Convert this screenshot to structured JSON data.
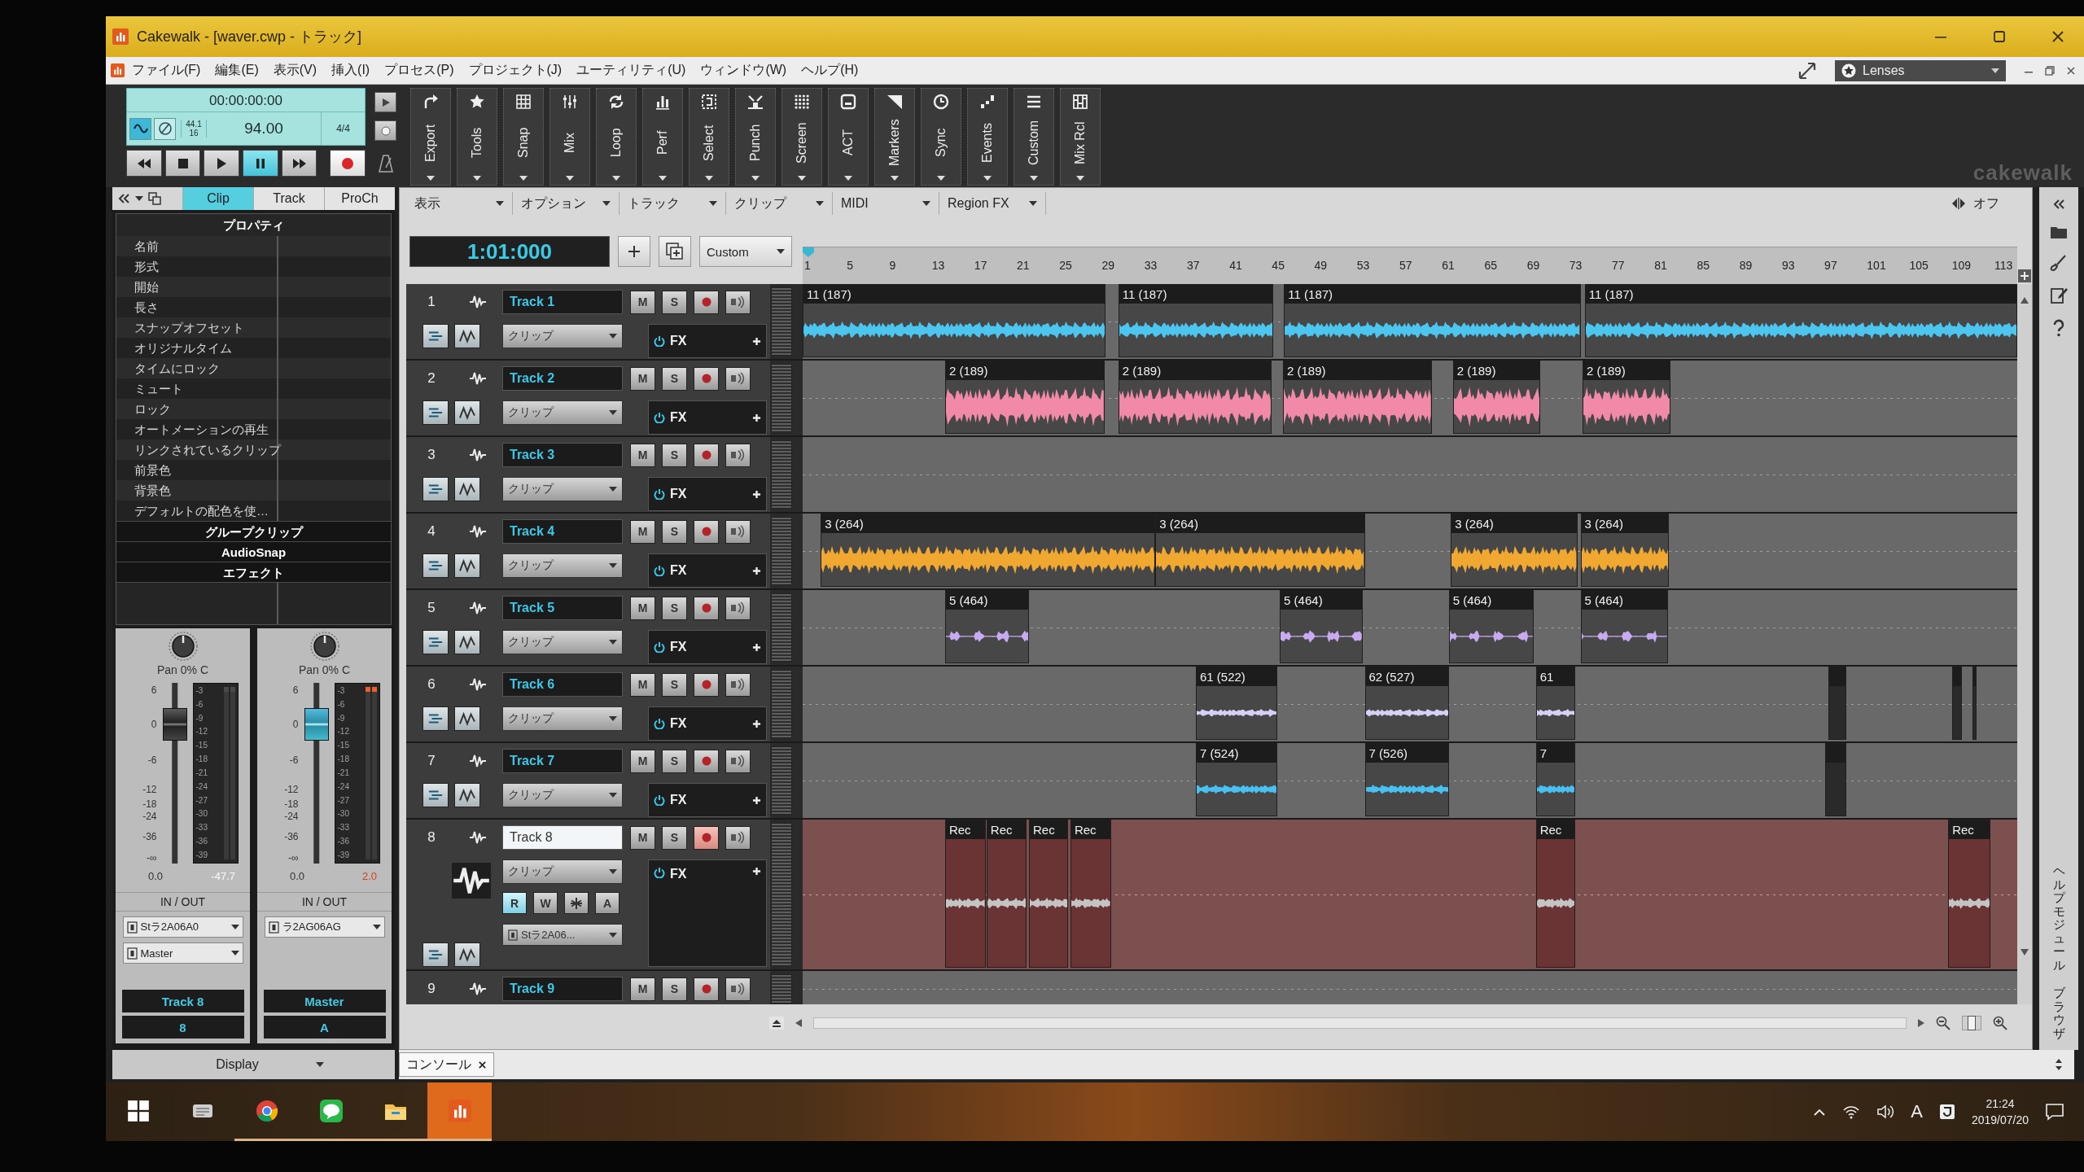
{
  "window": {
    "title": "Cakewalk - [waver.cwp - トラック]"
  },
  "menu": {
    "items": [
      "ファイル(F)",
      "編集(E)",
      "表示(V)",
      "挿入(I)",
      "プロセス(P)",
      "プロジェクト(J)",
      "ユーティリティ(U)",
      "ウィンドウ(W)",
      "ヘルプ(H)"
    ],
    "lenses": "Lenses"
  },
  "control_bar": {
    "transport": {
      "time": "00:00:00:00",
      "sample_rate": "44.1",
      "bit_depth": "16",
      "tempo": "94.00",
      "meter": "4/4",
      "toggles": [
        {
          "kind": "waveform",
          "on": true
        },
        {
          "kind": "slash",
          "on": false
        }
      ],
      "buttons": [
        {
          "kind": "rewind",
          "selected": false
        },
        {
          "kind": "stop",
          "selected": false
        },
        {
          "kind": "play",
          "selected": false
        },
        {
          "kind": "pause",
          "selected": true
        },
        {
          "kind": "forward",
          "selected": false
        },
        {
          "kind": "record",
          "selected": false
        }
      ]
    },
    "modules": [
      "Export",
      "Tools",
      "Snap",
      "Mix",
      "Loop",
      "Perf",
      "Select",
      "Punch",
      "Screen",
      "ACT",
      "Markers",
      "Sync",
      "Events",
      "Custom",
      "Mix Rcl"
    ],
    "brand": "cakewalk"
  },
  "inspector": {
    "tabs": [
      {
        "label": "Clip",
        "selected": true
      },
      {
        "label": "Track",
        "selected": false
      },
      {
        "label": "ProCh",
        "selected": false
      }
    ],
    "title": "プロパティ",
    "properties": [
      "名前",
      "形式",
      "開始",
      "長さ",
      "スナップオフセット",
      "オリジナルタイム",
      "タイムにロック",
      "ミュート",
      "ロック",
      "オートメーションの再生",
      "リンクされているクリップ",
      "前景色",
      "背景色",
      "デフォルトの配色を使…"
    ],
    "sections": [
      "グループクリップ",
      "AudioSnap",
      "エフェクト"
    ],
    "strips": [
      {
        "pan": "Pan 0% C",
        "fader_scale": [
          "6",
          "0",
          "-6",
          "-12",
          "-18",
          "-24",
          "-36",
          "-∞"
        ],
        "meter_scale": [
          "-3",
          "-6",
          "-9",
          "-12",
          "-15",
          "-18",
          "-21",
          "-24",
          "-27",
          "-30",
          "-33",
          "-36",
          "-39"
        ],
        "level": 0.77,
        "selected": false,
        "clipping": false,
        "gain": "0.0",
        "peak": "-47.7",
        "io_title": "IN / OUT",
        "input": "Stラ2A06A0",
        "output": "Master",
        "name": "Track 8",
        "number": "8"
      },
      {
        "pan": "Pan 0% C",
        "fader_scale": [
          "6",
          "0",
          "-6",
          "-12",
          "-18",
          "-24",
          "-36",
          "-∞"
        ],
        "meter_scale": [
          "-3",
          "-6",
          "-9",
          "-12",
          "-15",
          "-18",
          "-21",
          "-24",
          "-27",
          "-30",
          "-33",
          "-36",
          "-39"
        ],
        "level": 0.77,
        "selected": true,
        "clipping": true,
        "gain": "0.0",
        "peak": "2.0",
        "io_title": "IN / OUT",
        "input": "ラ2AG06AG",
        "name": "Master",
        "number": "A"
      }
    ],
    "display": "Display"
  },
  "track_view": {
    "menus": [
      "表示",
      "オプション",
      "トラック",
      "クリップ",
      "MIDI",
      "Region FX"
    ],
    "snap": "オフ",
    "now": "1:01:000",
    "preset": "Custom",
    "ruler": [
      "1",
      "5",
      "9",
      "13",
      "17",
      "21",
      "25",
      "29",
      "33",
      "37",
      "41",
      "45",
      "49",
      "53",
      "57",
      "61",
      "65",
      "69",
      "73",
      "77",
      "81",
      "85",
      "89",
      "93",
      "97",
      "101",
      "105",
      "109",
      "113"
    ],
    "tracks": [
      {
        "number": "1",
        "name": "Track 1",
        "selected": false,
        "expanded": false,
        "mode": "クリップ",
        "fx": "FX",
        "mute": {
          "label": "M",
          "on": false
        },
        "solo": {
          "label": "S",
          "on": false
        },
        "armed": false,
        "color": "#4cc6ee",
        "clips": [
          {
            "label": "11 (187)"
          },
          {
            "label": "11 (187)"
          },
          {
            "label": "11 (187)"
          },
          {
            "label": "11 (187)"
          }
        ]
      },
      {
        "number": "2",
        "name": "Track 2",
        "selected": false,
        "expanded": false,
        "mode": "クリップ",
        "fx": "FX",
        "mute": {
          "label": "M",
          "on": false
        },
        "solo": {
          "label": "S",
          "on": false
        },
        "armed": false,
        "color": "#f08aa8",
        "clips": [
          {
            "label": "2 (189)"
          },
          {
            "label": "2 (189)"
          },
          {
            "label": "2 (189)"
          },
          {
            "label": "2 (189)"
          },
          {
            "label": "2 (189)"
          }
        ]
      },
      {
        "number": "3",
        "name": "Track 3",
        "selected": false,
        "expanded": false,
        "mode": "クリップ",
        "fx": "FX",
        "mute": {
          "label": "M",
          "on": false
        },
        "solo": {
          "label": "S",
          "on": false
        },
        "armed": false
      },
      {
        "number": "4",
        "name": "Track 4",
        "selected": false,
        "expanded": false,
        "mode": "クリップ",
        "fx": "FX",
        "mute": {
          "label": "M",
          "on": false
        },
        "solo": {
          "label": "S",
          "on": false
        },
        "armed": false,
        "color": "#f0a830",
        "clips": [
          {
            "label": "3 (264)"
          },
          {
            "label": "3 (264)"
          },
          {
            "label": "3 (264)"
          },
          {
            "label": "3 (264)"
          }
        ]
      },
      {
        "number": "5",
        "name": "Track 5",
        "selected": false,
        "expanded": false,
        "mode": "クリップ",
        "fx": "FX",
        "mute": {
          "label": "M",
          "on": false
        },
        "solo": {
          "label": "S",
          "on": false
        },
        "armed": false,
        "color": "#c8aaf0",
        "clips": [
          {
            "label": "5 (464)"
          },
          {
            "label": "5 (464)"
          },
          {
            "label": "5 (464)"
          },
          {
            "label": "5 (464)"
          }
        ]
      },
      {
        "number": "6",
        "name": "Track 6",
        "selected": false,
        "expanded": false,
        "mode": "クリップ",
        "fx": "FX",
        "mute": {
          "label": "M",
          "on": false
        },
        "solo": {
          "label": "S",
          "on": false
        },
        "armed": false,
        "color": "#d6d0f6",
        "clips": [
          {
            "label": "61 (522)"
          },
          {
            "label": "62 (527)"
          },
          {
            "label": "61"
          }
        ]
      },
      {
        "number": "7",
        "name": "Track 7",
        "selected": false,
        "expanded": false,
        "mode": "クリップ",
        "fx": "FX",
        "mute": {
          "label": "M",
          "on": false
        },
        "solo": {
          "label": "S",
          "on": false
        },
        "armed": false,
        "color": "#48c0f0",
        "clips": [
          {
            "label": "7 (524)"
          },
          {
            "label": "7 (526)"
          },
          {
            "label": "7"
          }
        ]
      },
      {
        "number": "8",
        "name": "Track 8",
        "selected": true,
        "expanded": true,
        "mode": "クリップ",
        "fx": "FX",
        "mute": {
          "label": "M",
          "on": false
        },
        "solo": {
          "label": "S",
          "on": false
        },
        "armed": true,
        "automation": [
          {
            "kind": "letter",
            "label": "R",
            "on": true
          },
          {
            "kind": "letter",
            "label": "W",
            "on": false
          },
          {
            "kind": "icon",
            "on": false
          },
          {
            "kind": "letter",
            "label": "A",
            "on": false
          }
        ],
        "input": "Stラ2A06...",
        "color": "#c4c4c4",
        "clips": [
          {
            "label": "Rec"
          },
          {
            "label": "Rec"
          },
          {
            "label": "Rec"
          },
          {
            "label": "Rec"
          },
          {
            "label": "Rec"
          },
          {
            "label": "Rec"
          }
        ]
      },
      {
        "number": "9",
        "name": "Track 9",
        "selected": false,
        "expanded": false,
        "mute": {
          "label": "M",
          "on": false
        },
        "solo": {
          "label": "S",
          "on": false
        },
        "armed": false
      }
    ],
    "zoom": {
      "level": 0.5
    },
    "console": "コンソール"
  },
  "side_panel": {
    "tabs": [
      "ヘルプモジュール",
      "ブラウザ"
    ]
  },
  "taskbar": {
    "apps": [
      {
        "kind": "start",
        "running": false,
        "selected": false
      },
      {
        "kind": "device",
        "running": false,
        "selected": false
      },
      {
        "kind": "browser",
        "running": true,
        "selected": false
      },
      {
        "kind": "chat",
        "running": true,
        "selected": false
      },
      {
        "kind": "folder",
        "running": true,
        "selected": false
      },
      {
        "kind": "app",
        "running": true,
        "selected": true
      }
    ],
    "ime": "A",
    "time": "21:24",
    "date": "2019/07/20"
  }
}
